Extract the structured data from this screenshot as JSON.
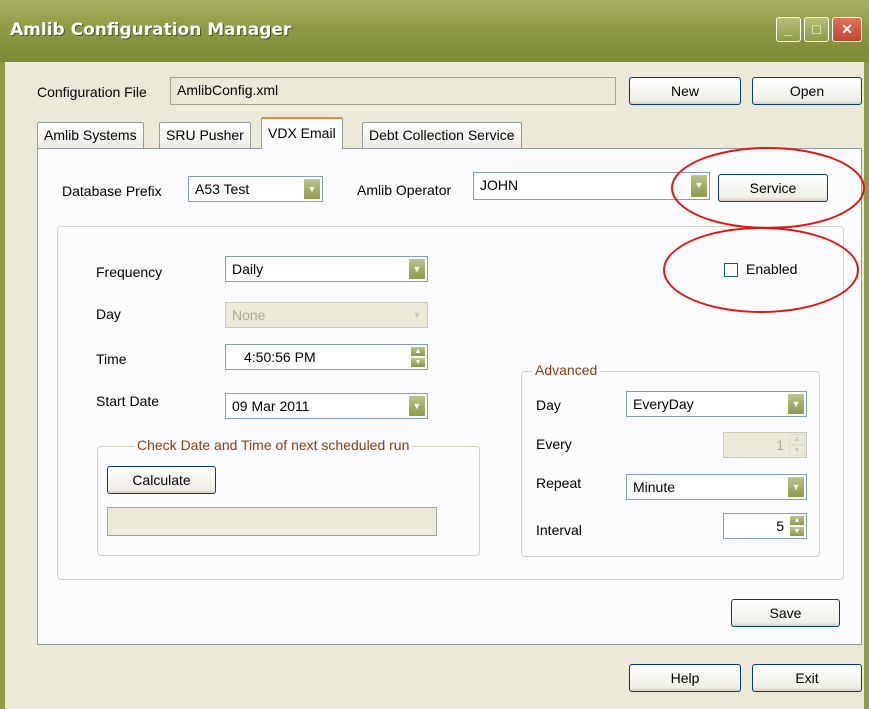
{
  "window": {
    "title": "Amlib Configuration Manager"
  },
  "config": {
    "label": "Configuration File",
    "value": "AmlibConfig.xml",
    "new_label": "New",
    "open_label": "Open"
  },
  "tabs": [
    {
      "label": "Amlib Systems"
    },
    {
      "label": "SRU Pusher"
    },
    {
      "label": "VDX Email"
    },
    {
      "label": "Debt Collection Service"
    }
  ],
  "vdx": {
    "db_prefix_label": "Database Prefix",
    "db_prefix_value": "A53 Test",
    "operator_label": "Amlib Operator",
    "operator_value": "JOHN",
    "service_label": "Service",
    "enabled_label": "Enabled",
    "enabled_checked": false,
    "frequency_label": "Frequency",
    "frequency_value": "Daily",
    "day_label": "Day",
    "day_value": "None",
    "time_label": "Time",
    "time_value": "4:50:56 PM",
    "start_label": "Start Date",
    "start_value": "09 Mar 2011",
    "check_title": "Check Date and Time of next scheduled run",
    "calculate_label": "Calculate",
    "calculate_result": "",
    "advanced": {
      "title": "Advanced",
      "day_label": "Day",
      "day_value": "EveryDay",
      "every_label": "Every",
      "every_value": "1",
      "repeat_label": "Repeat",
      "repeat_value": "Minute",
      "interval_label": "Interval",
      "interval_value": "5"
    },
    "save_label": "Save"
  },
  "footer": {
    "help_label": "Help",
    "exit_label": "Exit"
  },
  "colors": {
    "titlebar": "#8f9a44",
    "annotation": "#e21515",
    "active_tab_accent": "#e68b2c",
    "group_title": "#8b3a0f"
  }
}
